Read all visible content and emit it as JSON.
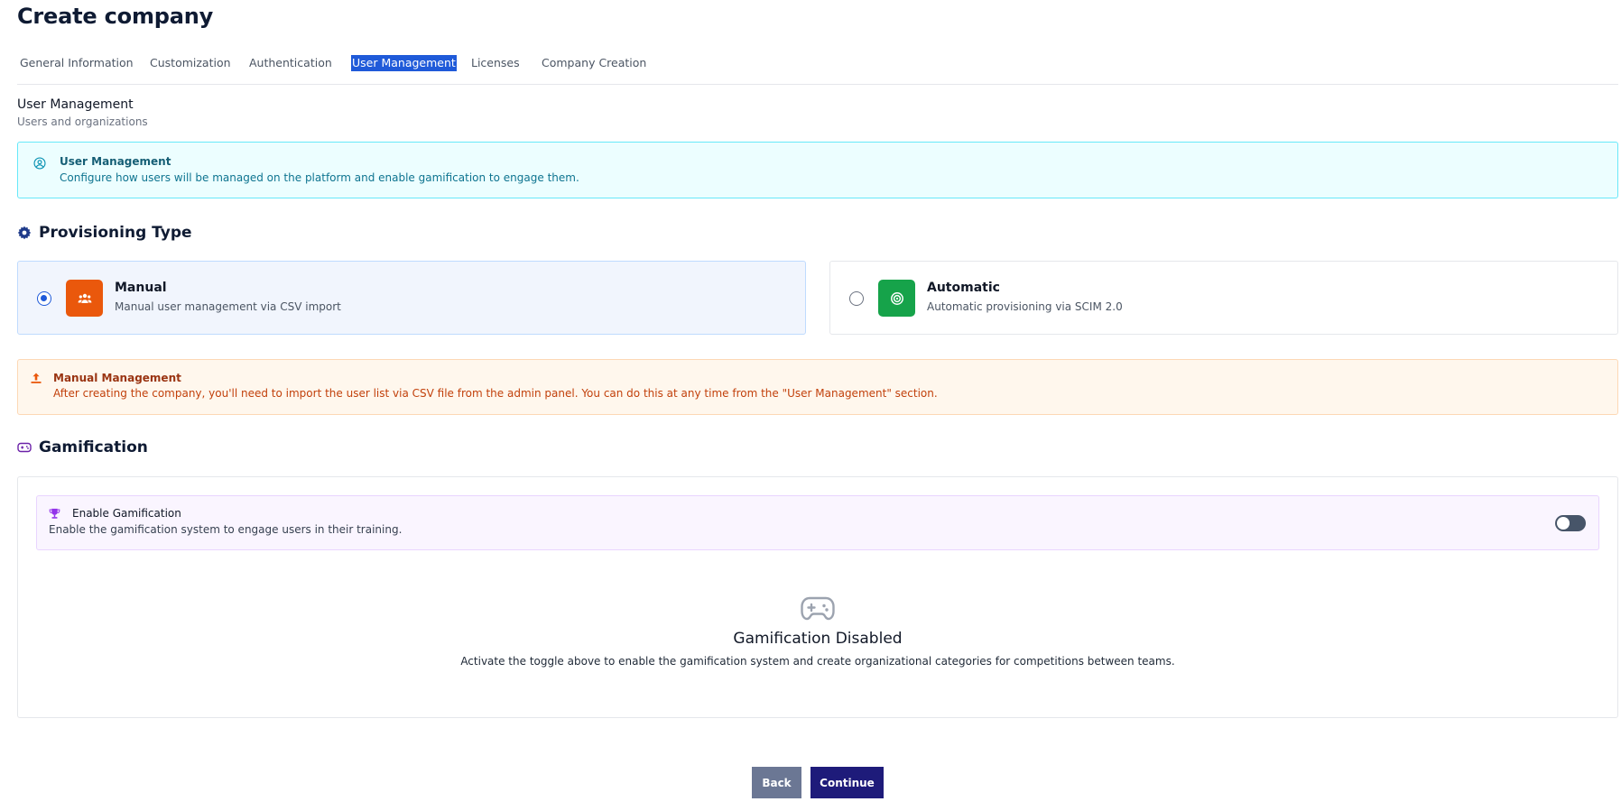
{
  "page": {
    "title": "Create company"
  },
  "tabs": [
    {
      "label": "General Information"
    },
    {
      "label": "Customization"
    },
    {
      "label": "Authentication"
    },
    {
      "label": "User Management"
    },
    {
      "label": "Licenses"
    },
    {
      "label": "Company Creation"
    }
  ],
  "active_tab": "User Management",
  "section": {
    "title": "User Management",
    "subtitle": "Users and organizations"
  },
  "info": {
    "icon": "user-circle-icon",
    "title": "User Management",
    "description": "Configure how users will be managed on the platform and enable gamification to engage them."
  },
  "provisioning": {
    "heading": "Provisioning Type",
    "icon": "gear-icon",
    "selected": "Manual",
    "options": [
      {
        "title": "Manual",
        "description": "Manual user management via CSV import",
        "icon": "users-icon",
        "color": "#ea580c"
      },
      {
        "title": "Automatic",
        "description": "Automatic provisioning via SCIM 2.0",
        "icon": "target-icon",
        "color": "#16a34a"
      }
    ]
  },
  "notice": {
    "icon": "upload-icon",
    "title": "Manual Management",
    "description": "After creating the company, you'll need to import the user list via CSV file from the admin panel. You can do this at any time from the \"User Management\" section."
  },
  "gamification": {
    "heading": "Gamification",
    "icon": "gamepad-icon",
    "toggle": {
      "icon": "trophy-icon",
      "title": "Enable Gamification",
      "description": "Enable the gamification system to engage users in their training.",
      "enabled": false
    },
    "empty_state": {
      "icon": "gamepad-icon",
      "title": "Gamification Disabled",
      "description": "Activate the toggle above to enable the gamification system and create organizational categories for competitions between teams."
    }
  },
  "actions": {
    "back": "Back",
    "continue": "Continue"
  },
  "colors": {
    "primary": "#1e1b7a",
    "tab_active": "#1f5ad9",
    "info_bg": "#ecfeff",
    "warn_bg": "#fff7ed",
    "gam_bg": "#faf5ff"
  }
}
